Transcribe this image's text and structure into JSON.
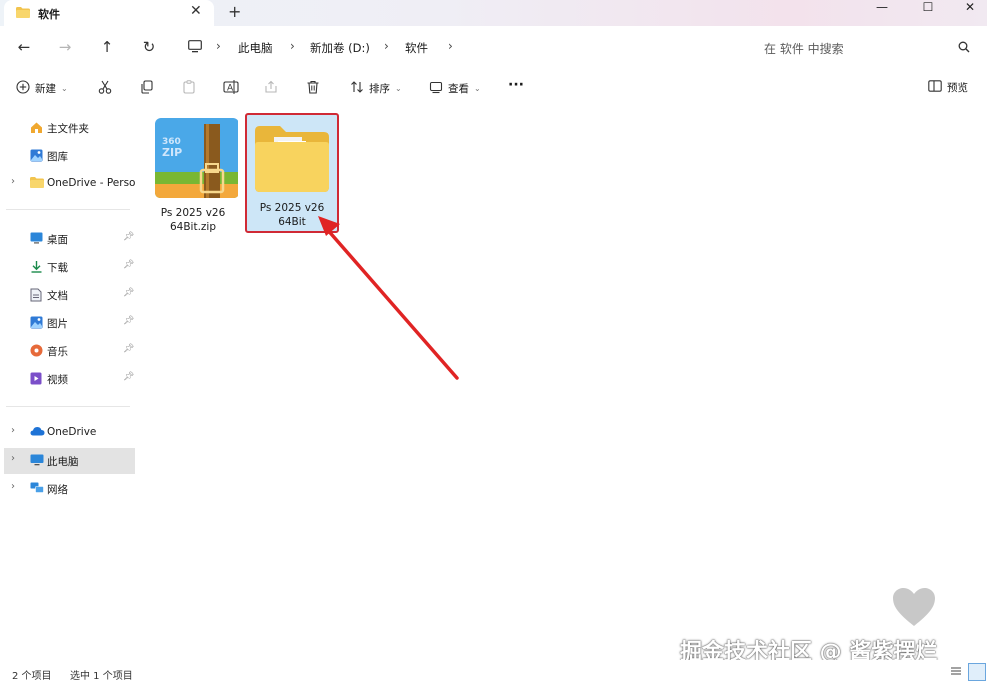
{
  "window": {
    "tab_title": "软件",
    "new_tab": "+",
    "controls": {
      "minimize": "—",
      "maximize": "☐",
      "close": "✕"
    }
  },
  "nav": {
    "back": "←",
    "forward": "→",
    "up": "↑",
    "refresh": "↻",
    "breadcrumbs": [
      "此电脑",
      "新加卷 (D:)",
      "软件"
    ],
    "search_placeholder": "在 软件 中搜索"
  },
  "toolbar": {
    "new_label": "新建",
    "sort_label": "排序",
    "view_label": "查看",
    "more_label": "···",
    "preview_label": "预览"
  },
  "sidebar": {
    "quick": [
      {
        "label": "主文件夹",
        "icon": "home-icon"
      },
      {
        "label": "图库",
        "icon": "gallery-icon"
      },
      {
        "label": "OneDrive - Personal",
        "icon": "folder-icon"
      }
    ],
    "pinned": [
      {
        "label": "桌面",
        "icon": "desktop-icon"
      },
      {
        "label": "下载",
        "icon": "download-icon"
      },
      {
        "label": "文档",
        "icon": "document-icon"
      },
      {
        "label": "图片",
        "icon": "pictures-icon"
      },
      {
        "label": "音乐",
        "icon": "music-icon"
      },
      {
        "label": "视频",
        "icon": "video-icon"
      }
    ],
    "locations": [
      {
        "label": "OneDrive",
        "icon": "cloud-icon"
      },
      {
        "label": "此电脑",
        "icon": "computer-icon",
        "selected": true
      },
      {
        "label": "网络",
        "icon": "network-icon"
      }
    ]
  },
  "files": [
    {
      "name_line1": "Ps 2025 v26",
      "name_line2": "64Bit.zip",
      "type": "zip",
      "icon_text": "360 ZIP"
    },
    {
      "name_line1": "Ps 2025 v26",
      "name_line2": "64Bit",
      "type": "folder",
      "selected": true
    }
  ],
  "status": {
    "count": "2 个项目",
    "selected": "选中 1 个项目"
  },
  "watermark": "掘金技术社区 @ 酱紫摆烂",
  "colors": {
    "selection_fill": "#cde6f7",
    "highlight_border": "#d02a35",
    "arrow": "#e02424",
    "folder": "#f6cf5b"
  }
}
